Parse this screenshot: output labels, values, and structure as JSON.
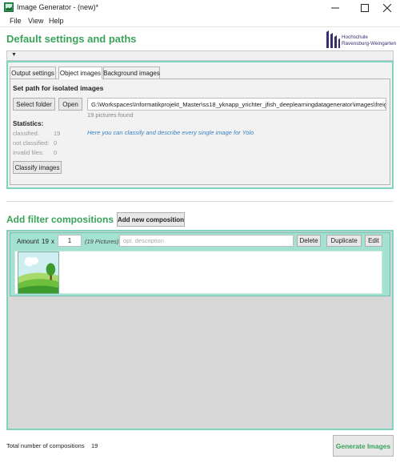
{
  "window": {
    "title": "Image Generator - (new)*",
    "icon": "app-icon",
    "controls": [
      "minimize-icon",
      "maximize-icon",
      "close-icon"
    ]
  },
  "menu": {
    "items": [
      "File",
      "View",
      "Help"
    ]
  },
  "header": {
    "title": "Default settings and paths",
    "logo_line1": "Hochschule",
    "logo_line2": "Ravensburg-Weingarten"
  },
  "settings": {
    "collapse_icon": "chevron-down-icon",
    "tabs": [
      "Output settings",
      "Object images",
      "Background images"
    ],
    "active_tab": "Object images",
    "path_heading": "Set path for isolated images",
    "select_folder_label": "Select folder",
    "open_label": "Open",
    "path_value": "G:\\Workspaces\\Informatikprojekt_Master\\ss18_yknapp_yrichter_jfish_deeplearningdatagenerator\\images\\freige",
    "pictures_found": "19 pictures found",
    "stats_heading": "Statistics:",
    "stats": [
      {
        "label": "classified:",
        "value": "19"
      },
      {
        "label": "not classified:",
        "value": "0"
      },
      {
        "label": "invalid files:",
        "value": "0"
      }
    ],
    "hint": "Here you can classify and describe every single image for Yolo",
    "classify_label": "Classify images"
  },
  "filters": {
    "heading": "Add filter compositions",
    "add_label": "Add new composition",
    "composition": {
      "amount_label": "Amount",
      "amount_value": "19",
      "x_label": "x",
      "amount_input": "1",
      "picture_count": "(19 Pictures)",
      "description_placeholder": "opt. description",
      "delete_label": "Delete",
      "duplicate_label": "Duplicate",
      "edit_label": "Edit",
      "thumbnail": "landscape-thumbnail"
    }
  },
  "footer": {
    "total_label": "Total number of compositions",
    "total_value": "19",
    "generate_label": "Generate Images"
  },
  "colors": {
    "accent_green": "#3aa35a",
    "teal_border": "#7fd3c0",
    "teal_card": "#a3e1d1",
    "hint_blue": "#3a82c4"
  }
}
